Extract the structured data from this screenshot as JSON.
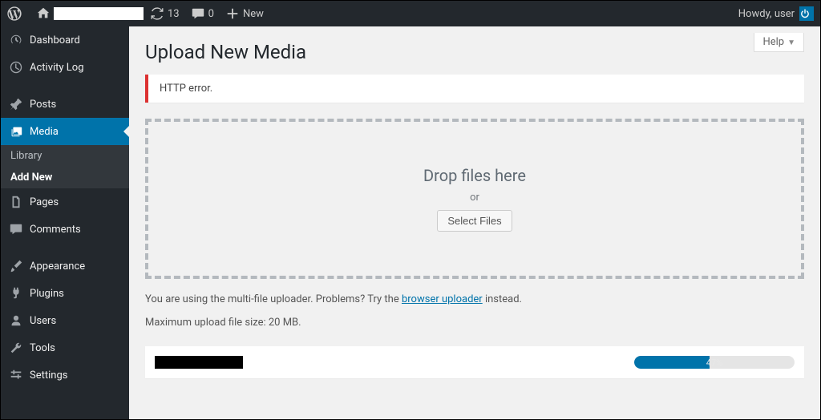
{
  "adminbar": {
    "updates_count": "13",
    "comments_count": "0",
    "new_label": "New",
    "howdy": "Howdy, user"
  },
  "sidebar": {
    "dashboard": "Dashboard",
    "activity_log": "Activity Log",
    "posts": "Posts",
    "media": "Media",
    "media_sub_library": "Library",
    "media_sub_addnew": "Add New",
    "pages": "Pages",
    "comments": "Comments",
    "appearance": "Appearance",
    "plugins": "Plugins",
    "users": "Users",
    "tools": "Tools",
    "settings": "Settings"
  },
  "main": {
    "help": "Help",
    "title": "Upload New Media",
    "error": "HTTP error.",
    "drop_label": "Drop files here",
    "or": "or",
    "select_files": "Select Files",
    "info_pre": "You are using the multi-file uploader. Problems? Try the ",
    "info_link": "browser uploader",
    "info_post": " instead.",
    "max_size": "Maximum upload file size: 20 MB.",
    "progress_percent": 47,
    "progress_label": "47%"
  }
}
